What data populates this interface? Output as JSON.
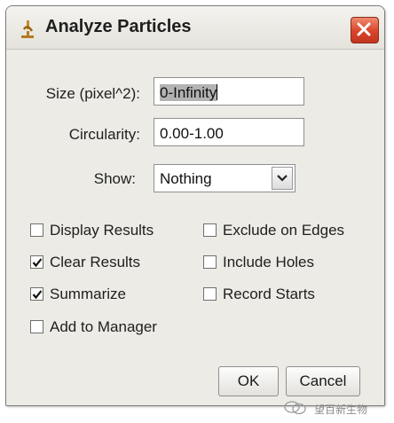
{
  "window": {
    "title": "Analyze Particles",
    "icon": "microscope-icon",
    "close_icon": "close-icon"
  },
  "fields": {
    "size_label": "Size (pixel^2):",
    "size_value": "0-Infinity",
    "circularity_label": "Circularity:",
    "circularity_value": "0.00-1.00",
    "show_label": "Show:",
    "show_value": "Nothing"
  },
  "checkboxes": [
    {
      "label": "Display Results",
      "checked": false
    },
    {
      "label": "Exclude on Edges",
      "checked": false
    },
    {
      "label": "Clear Results",
      "checked": true
    },
    {
      "label": "Include Holes",
      "checked": false
    },
    {
      "label": "Summarize",
      "checked": true
    },
    {
      "label": "Record Starts",
      "checked": false
    },
    {
      "label": "Add to Manager",
      "checked": false
    }
  ],
  "buttons": {
    "ok": "OK",
    "cancel": "Cancel"
  },
  "watermark": {
    "right_text": "望百新生物"
  }
}
